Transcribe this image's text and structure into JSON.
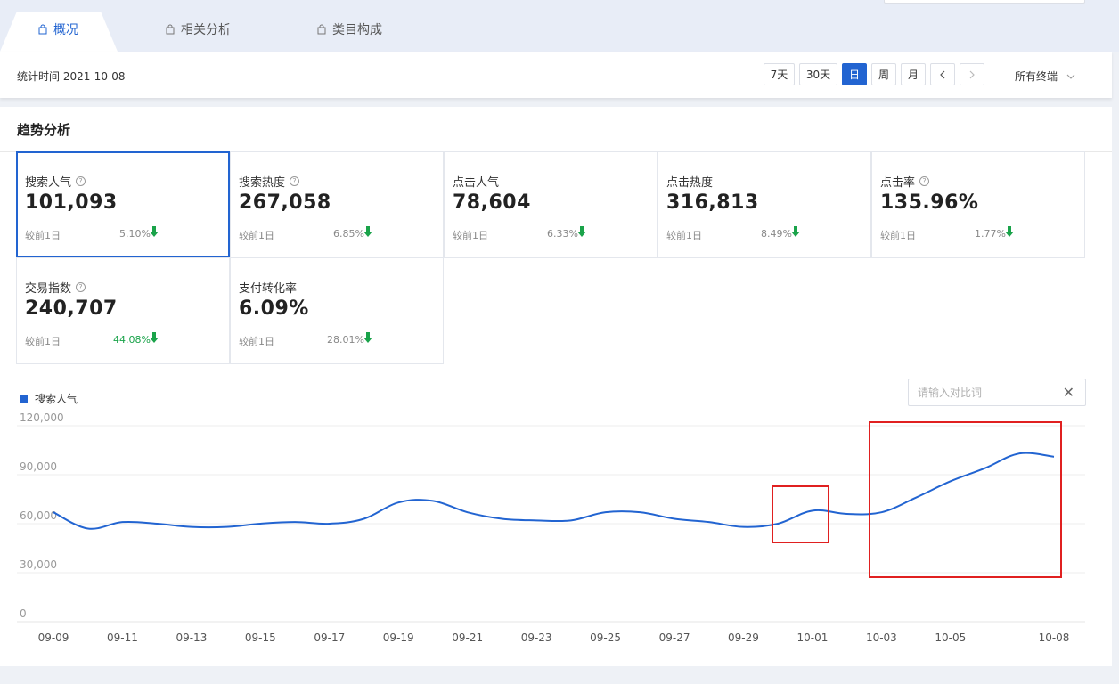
{
  "tabs": [
    {
      "label": "概况",
      "active": true
    },
    {
      "label": "相关分析",
      "active": false
    },
    {
      "label": "类目构成",
      "active": false
    }
  ],
  "stat_time": "统计时间 2021-10-08",
  "period_buttons": [
    {
      "label": "7天",
      "selected": false
    },
    {
      "label": "30天",
      "selected": false
    },
    {
      "label": "日",
      "selected": true
    },
    {
      "label": "周",
      "selected": false
    },
    {
      "label": "月",
      "selected": false
    }
  ],
  "terminal_select": "所有终端",
  "section_title": "趋势分析",
  "metrics": [
    {
      "name": "搜索人气",
      "value": "101,093",
      "compare_label": "较前1日",
      "change": "5.10%",
      "direction": "down",
      "help": true
    },
    {
      "name": "搜索热度",
      "value": "267,058",
      "compare_label": "较前1日",
      "change": "6.85%",
      "direction": "down",
      "help": true
    },
    {
      "name": "点击人气",
      "value": "78,604",
      "compare_label": "较前1日",
      "change": "6.33%",
      "direction": "down",
      "help": false
    },
    {
      "name": "点击热度",
      "value": "316,813",
      "compare_label": "较前1日",
      "change": "8.49%",
      "direction": "down",
      "help": false
    },
    {
      "name": "点击率",
      "value": "135.96%",
      "compare_label": "较前1日",
      "change": "1.77%",
      "direction": "down",
      "help": true
    },
    {
      "name": "交易指数",
      "value": "240,707",
      "compare_label": "较前1日",
      "change": "44.08%",
      "direction": "down",
      "help": true
    },
    {
      "name": "支付转化率",
      "value": "6.09%",
      "compare_label": "较前1日",
      "change": "28.01%",
      "direction": "down",
      "help": false
    }
  ],
  "compare_input": {
    "placeholder": "请输入对比词",
    "clear_icon": "close-icon"
  },
  "colors": {
    "accent": "#2264d1",
    "down": "#1aa34a",
    "highlight": "#e02020"
  },
  "chart_data": {
    "type": "line",
    "series": [
      {
        "name": "搜索人气",
        "color": "#2264d1",
        "values": [
          67000,
          57000,
          61000,
          60000,
          58000,
          58000,
          60000,
          61000,
          60000,
          63000,
          73000,
          74000,
          67000,
          63000,
          62000,
          62000,
          67000,
          67000,
          63000,
          61000,
          58000,
          60000,
          68000,
          66000,
          67000,
          76000,
          86000,
          94000,
          103000,
          101000
        ]
      }
    ],
    "x": [
      "09-09",
      "09-10",
      "09-11",
      "09-12",
      "09-13",
      "09-14",
      "09-15",
      "09-16",
      "09-17",
      "09-18",
      "09-19",
      "09-20",
      "09-21",
      "09-22",
      "09-23",
      "09-24",
      "09-25",
      "09-26",
      "09-27",
      "09-28",
      "09-29",
      "09-30",
      "10-01",
      "10-02",
      "10-03",
      "10-04",
      "10-05",
      "10-06",
      "10-07",
      "10-08"
    ],
    "x_tick_labels": [
      "09-09",
      "09-11",
      "09-13",
      "09-15",
      "09-17",
      "09-19",
      "09-21",
      "09-23",
      "09-25",
      "09-27",
      "09-29",
      "10-01",
      "10-03",
      "10-05",
      "10-08"
    ],
    "y_tick_labels": [
      "0",
      "30,000",
      "60,000",
      "90,000",
      "120,000"
    ],
    "ylim": [
      0,
      120000
    ],
    "grid": true,
    "legend": "top-left",
    "highlights": [
      {
        "from": "09-30",
        "to": "10-01"
      },
      {
        "from": "10-03",
        "to": "10-08"
      }
    ]
  }
}
